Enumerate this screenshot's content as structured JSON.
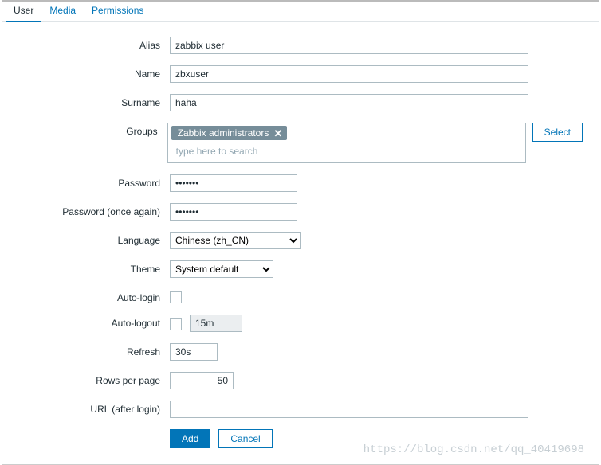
{
  "tabs": {
    "user": "User",
    "media": "Media",
    "permissions": "Permissions"
  },
  "labels": {
    "alias": "Alias",
    "name": "Name",
    "surname": "Surname",
    "groups": "Groups",
    "password": "Password",
    "password2": "Password (once again)",
    "language": "Language",
    "theme": "Theme",
    "autoLogin": "Auto-login",
    "autoLogout": "Auto-logout",
    "refresh": "Refresh",
    "rowsPerPage": "Rows per page",
    "urlAfterLogin": "URL (after login)"
  },
  "values": {
    "alias": "zabbix user",
    "name": "zbxuser",
    "surname": "haha",
    "groupChip": "Zabbix administrators",
    "groupSearchPlaceholder": "type here to search",
    "password": "•••••••",
    "password2": "•••••••",
    "language": "Chinese (zh_CN)",
    "theme": "System default",
    "autoLogoutValue": "15m",
    "refresh": "30s",
    "rowsPerPage": "50",
    "urlAfterLogin": ""
  },
  "buttons": {
    "select": "Select",
    "add": "Add",
    "cancel": "Cancel"
  },
  "watermark": "https://blog.csdn.net/qq_40419698"
}
